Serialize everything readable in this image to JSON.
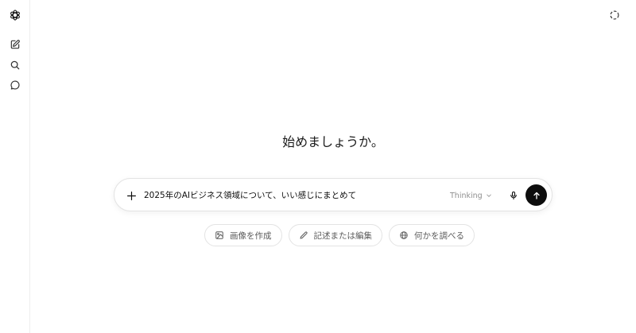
{
  "sidebar": {
    "logo_icon": "openai-logo-icon",
    "items": [
      {
        "name": "new-chat",
        "icon": "edit-icon"
      },
      {
        "name": "search",
        "icon": "search-icon"
      },
      {
        "name": "chats",
        "icon": "chat-bubble-icon"
      }
    ]
  },
  "header": {
    "temporary_chat_icon": "dashed-circle-icon"
  },
  "main": {
    "heading": "始めましょうか。",
    "composer": {
      "value": "2025年のAIビジネス領域について、いい感じにまとめて",
      "model_label": "Thinking",
      "send_icon": "arrow-up-icon",
      "mic_icon": "microphone-icon",
      "plus_icon": "plus-icon"
    },
    "suggestions": [
      {
        "label": "画像を作成",
        "icon": "image-icon"
      },
      {
        "label": "記述または編集",
        "icon": "pencil-icon"
      },
      {
        "label": "何かを調べる",
        "icon": "globe-icon"
      }
    ]
  },
  "colors": {
    "text": "#0d0d0d",
    "muted": "#8f8f8f",
    "border": "#e3e3e3",
    "send_button": "#0d0d0d"
  }
}
